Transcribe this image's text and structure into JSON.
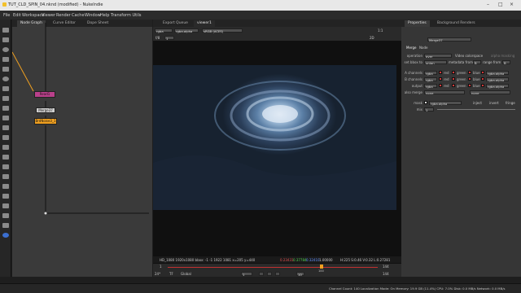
{
  "window": {
    "title": "TUT_CLD_SPIN_04.nknd (modified) - NukeIndie"
  },
  "menu": [
    "File",
    "Edit",
    "Workspace",
    "Viewer",
    "Render",
    "Cache",
    "Window",
    "Help",
    "Transform Utils"
  ],
  "node_graph": {
    "tabs": [
      "Node Graph",
      "Curve Editor",
      "Dope Sheet"
    ],
    "nodes": [
      {
        "label": "Read1"
      },
      {
        "label": "Merge37"
      },
      {
        "label": "BrdNoise3_1"
      }
    ]
  },
  "viewer": {
    "tabs": [
      "Export Queue",
      "viewer1"
    ],
    "channels": "rgba",
    "alpha": "rgba.alpha",
    "colorspace": "sRGB (ACES)",
    "frame_field": "f/8",
    "frame_num": "1",
    "zoom": "1:1",
    "proxy": "2D",
    "format_info": "HD_1080 1920x1080  bbox: -1 -1 1922 1081  x=205 y=440",
    "pixel_values": [
      "0.23431",
      "0.37784",
      "0.32410",
      "1.00000"
    ],
    "hsv_info": "H:225 S:0.46 V:0.32  L:0.27281",
    "timeline": {
      "start": "1",
      "end": "144",
      "current": "100",
      "fps": "24*",
      "tf": "TF",
      "global": "Global",
      "frame_field": "1",
      "in_point": "1",
      "out_point": "144",
      "step": "10"
    }
  },
  "properties": {
    "tabs": [
      "Properties",
      "Background Renders"
    ],
    "node_name": "Merge37",
    "sub_tabs": [
      "Merge",
      "Node"
    ],
    "operation_label": "operation",
    "operation": "over",
    "video_colorspace": "Video colorspace",
    "alpha_masking": "alpha masking",
    "set_bbox_label": "set bbox to",
    "set_bbox": "union",
    "metadata_label": "metadata from",
    "metadata": "B",
    "range_label": "range from",
    "range": "B",
    "rows": [
      {
        "label": "A channels",
        "value": "rgba",
        "chk": [
          "red",
          "green",
          "blue",
          "rgba.alpha"
        ]
      },
      {
        "label": "B channels",
        "value": "rgba",
        "chk": [
          "red",
          "green",
          "blue",
          "rgba.alpha"
        ]
      },
      {
        "label": "output",
        "value": "rgba",
        "chk": [
          "red",
          "green",
          "blue",
          "rgba.alpha"
        ]
      },
      {
        "label": "also merge",
        "value": "none",
        "chk": []
      }
    ],
    "also_merge_second": "none",
    "mask_label": "mask",
    "mask_value": "rgba.alpha",
    "inject": "inject",
    "invert": "invert",
    "fringe": "fringe",
    "mix_label": "mix",
    "mix_value": "1"
  },
  "statusbar": {
    "text": "Channel Count: 140  Localization Mode: On  Memory: 19.9 GB (11.4%)  CPU: 7.0%  Disk: 0.0 MB/s  Network: 0.0 MB/s"
  }
}
